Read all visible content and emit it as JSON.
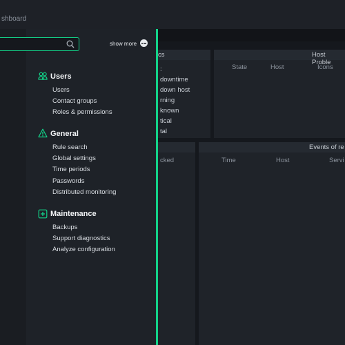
{
  "breadcrumb": "shboard",
  "background": {
    "panel_left_title": "cs",
    "panel_right_title": "Host Proble",
    "host_problem_columns": [
      "State",
      "Host",
      "Icons"
    ],
    "stats_items": [
      ":",
      "downtime",
      "down host",
      "rning",
      "known",
      "tical",
      "tal"
    ],
    "panel_bottom_left_col": "cked",
    "panel_bottom_right_title": "Events of re",
    "events_columns": [
      "Time",
      "Host",
      "Servi"
    ]
  },
  "flyout": {
    "show_more_label": "show more",
    "sections": [
      {
        "title": "Users",
        "icon": "users-icon",
        "links": [
          "Users",
          "Contact groups",
          "Roles & permissions"
        ]
      },
      {
        "title": "General",
        "icon": "warning-icon",
        "links": [
          "Rule search",
          "Global settings",
          "Time periods",
          "Passwords",
          "Distributed monitoring"
        ]
      },
      {
        "title": "Maintenance",
        "icon": "plus-box-icon",
        "links": [
          "Backups",
          "Support diagnostics",
          "Analyze configuration"
        ]
      }
    ]
  },
  "colors": {
    "accent": "#13d389",
    "background": "#15181d",
    "panel": "#1f2329"
  }
}
